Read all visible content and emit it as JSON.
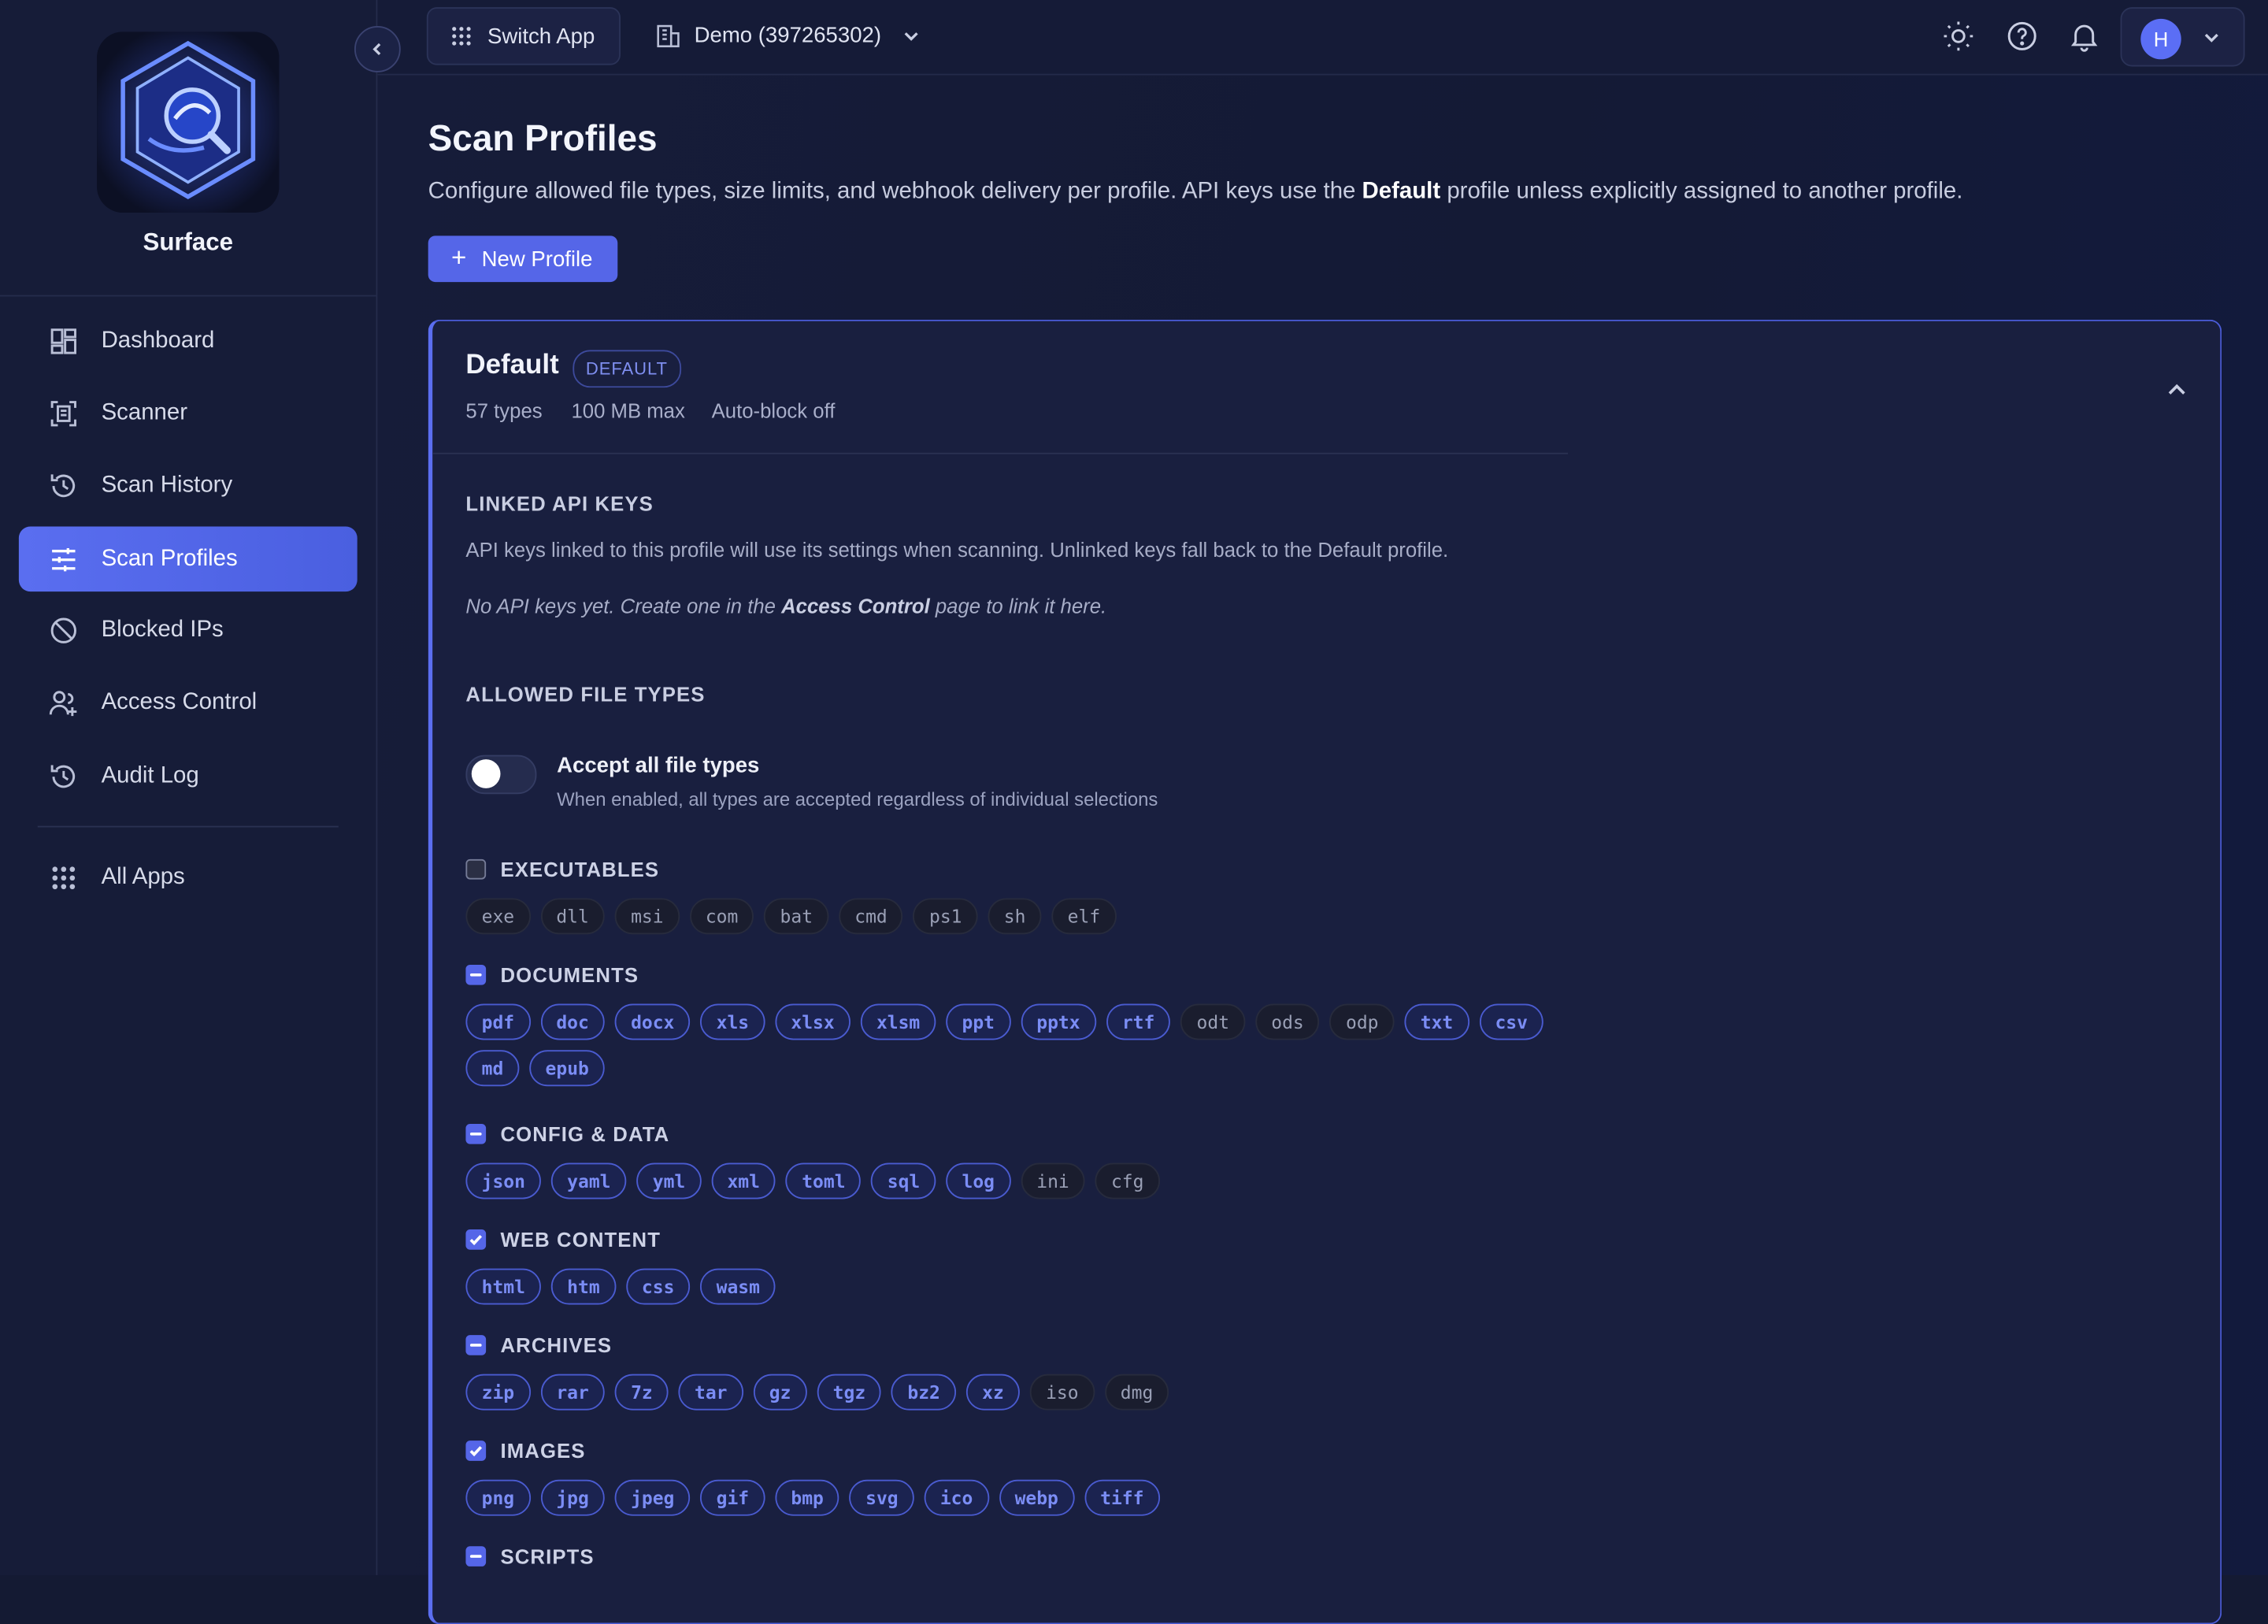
{
  "app": {
    "brand": "Surface"
  },
  "sidebar": {
    "items": [
      {
        "label": "Dashboard",
        "icon": "dashboard-icon"
      },
      {
        "label": "Scanner",
        "icon": "scanner-icon"
      },
      {
        "label": "Scan History",
        "icon": "history-icon"
      },
      {
        "label": "Scan Profiles",
        "icon": "sliders-icon",
        "active": true
      },
      {
        "label": "Blocked IPs",
        "icon": "ban-icon"
      },
      {
        "label": "Access Control",
        "icon": "user-access-icon"
      },
      {
        "label": "Audit Log",
        "icon": "history-icon"
      }
    ],
    "all_apps": "All Apps"
  },
  "topbar": {
    "switch_app": "Switch App",
    "org_selector": "Demo (397265302)",
    "user_initial": "H"
  },
  "page": {
    "title": "Scan Profiles",
    "description_pre": "Configure allowed file types, size limits, and webhook delivery per profile. API keys use the ",
    "description_bold": "Default",
    "description_post": " profile unless explicitly assigned to another profile.",
    "new_profile": "New Profile"
  },
  "profile": {
    "name": "Default",
    "badge": "DEFAULT",
    "types_count": "57 types",
    "max_size": "100 MB max",
    "auto_block": "Auto-block off",
    "linked_keys_title": "LINKED API KEYS",
    "linked_keys_desc": "API keys linked to this profile will use its settings when scanning. Unlinked keys fall back to the Default profile.",
    "no_keys_pre": "No API keys yet. Create one in the ",
    "no_keys_bold": "Access Control",
    "no_keys_post": " page to link it here.",
    "allowed_types_title": "ALLOWED FILE TYPES",
    "accept_all_label": "Accept all file types",
    "accept_all_sub": "When enabled, all types are accepted regardless of individual selections",
    "accept_all_enabled": false
  },
  "categories": [
    {
      "label": "EXECUTABLES",
      "state": "off",
      "types": [
        {
          "ext": "exe",
          "on": false
        },
        {
          "ext": "dll",
          "on": false
        },
        {
          "ext": "msi",
          "on": false
        },
        {
          "ext": "com",
          "on": false
        },
        {
          "ext": "bat",
          "on": false
        },
        {
          "ext": "cmd",
          "on": false
        },
        {
          "ext": "ps1",
          "on": false
        },
        {
          "ext": "sh",
          "on": false
        },
        {
          "ext": "elf",
          "on": false
        }
      ]
    },
    {
      "label": "DOCUMENTS",
      "state": "mixed",
      "types": [
        {
          "ext": "pdf",
          "on": true
        },
        {
          "ext": "doc",
          "on": true
        },
        {
          "ext": "docx",
          "on": true
        },
        {
          "ext": "xls",
          "on": true
        },
        {
          "ext": "xlsx",
          "on": true
        },
        {
          "ext": "xlsm",
          "on": true
        },
        {
          "ext": "ppt",
          "on": true
        },
        {
          "ext": "pptx",
          "on": true
        },
        {
          "ext": "rtf",
          "on": true
        },
        {
          "ext": "odt",
          "on": false
        },
        {
          "ext": "ods",
          "on": false
        },
        {
          "ext": "odp",
          "on": false
        },
        {
          "ext": "txt",
          "on": true
        },
        {
          "ext": "csv",
          "on": true
        },
        {
          "ext": "md",
          "on": true
        },
        {
          "ext": "epub",
          "on": true
        }
      ]
    },
    {
      "label": "CONFIG & DATA",
      "state": "mixed",
      "types": [
        {
          "ext": "json",
          "on": true
        },
        {
          "ext": "yaml",
          "on": true
        },
        {
          "ext": "yml",
          "on": true
        },
        {
          "ext": "xml",
          "on": true
        },
        {
          "ext": "toml",
          "on": true
        },
        {
          "ext": "sql",
          "on": true
        },
        {
          "ext": "log",
          "on": true
        },
        {
          "ext": "ini",
          "on": false
        },
        {
          "ext": "cfg",
          "on": false
        }
      ]
    },
    {
      "label": "WEB CONTENT",
      "state": "on",
      "types": [
        {
          "ext": "html",
          "on": true
        },
        {
          "ext": "htm",
          "on": true
        },
        {
          "ext": "css",
          "on": true
        },
        {
          "ext": "wasm",
          "on": true
        }
      ]
    },
    {
      "label": "ARCHIVES",
      "state": "mixed",
      "types": [
        {
          "ext": "zip",
          "on": true
        },
        {
          "ext": "rar",
          "on": true
        },
        {
          "ext": "7z",
          "on": true
        },
        {
          "ext": "tar",
          "on": true
        },
        {
          "ext": "gz",
          "on": true
        },
        {
          "ext": "tgz",
          "on": true
        },
        {
          "ext": "bz2",
          "on": true
        },
        {
          "ext": "xz",
          "on": true
        },
        {
          "ext": "iso",
          "on": false
        },
        {
          "ext": "dmg",
          "on": false
        }
      ]
    },
    {
      "label": "IMAGES",
      "state": "on",
      "types": [
        {
          "ext": "png",
          "on": true
        },
        {
          "ext": "jpg",
          "on": true
        },
        {
          "ext": "jpeg",
          "on": true
        },
        {
          "ext": "gif",
          "on": true
        },
        {
          "ext": "bmp",
          "on": true
        },
        {
          "ext": "svg",
          "on": true
        },
        {
          "ext": "ico",
          "on": true
        },
        {
          "ext": "webp",
          "on": true
        },
        {
          "ext": "tiff",
          "on": true
        }
      ]
    },
    {
      "label": "SCRIPTS",
      "state": "mixed",
      "types": []
    }
  ],
  "colors": {
    "accent": "#5566e8",
    "accent_text": "#7b8df5",
    "background": "#141a33"
  }
}
